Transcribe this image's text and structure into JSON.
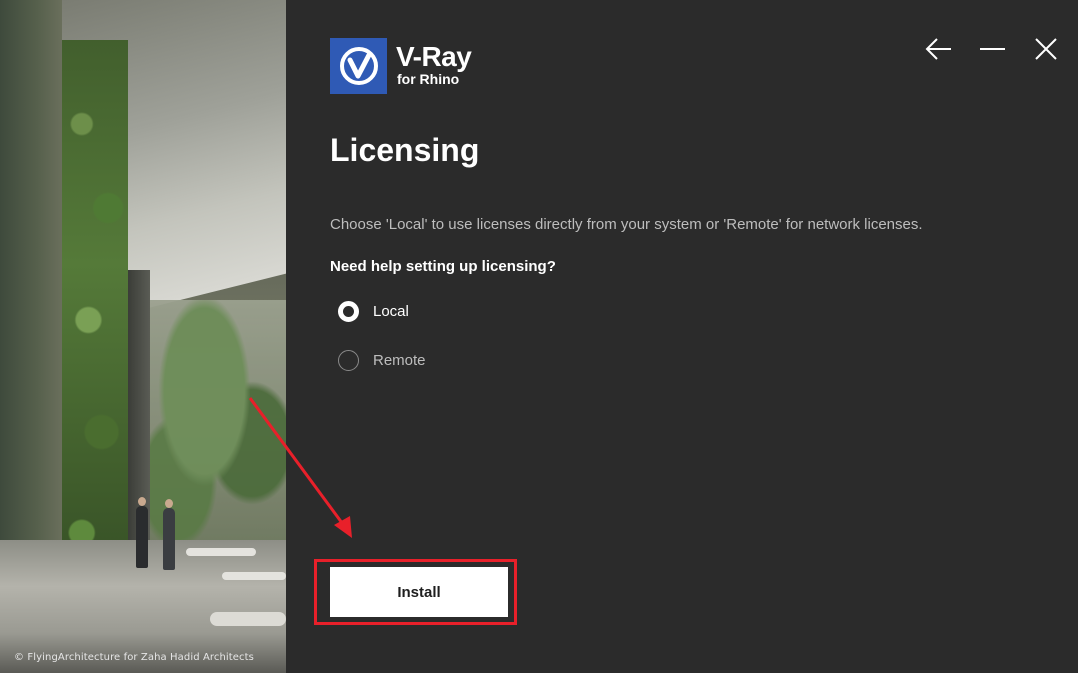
{
  "background_photo": {
    "credit": "© FlyingArchitecture for Zaha Hadid Architects"
  },
  "brand": {
    "name": "V-Ray",
    "subtitle": "for Rhino",
    "logo_color": "#2f5ab5",
    "logo_icon": "v-ray-logo-icon"
  },
  "window_controls": {
    "back_icon": "arrow-left-icon",
    "minimize_icon": "minimize-icon",
    "close_icon": "close-icon"
  },
  "page": {
    "title": "Licensing",
    "description": "Choose 'Local' to use licenses directly from your system or 'Remote' for network licenses.",
    "help_link": "Need help setting up licensing?"
  },
  "license_options": [
    {
      "label": "Local",
      "selected": true
    },
    {
      "label": "Remote",
      "selected": false
    }
  ],
  "actions": {
    "install_label": "Install"
  },
  "annotation": {
    "highlight_color": "#e8202a"
  },
  "colors": {
    "panel_background": "#2b2b2b",
    "muted_text": "#bdbdbd"
  }
}
